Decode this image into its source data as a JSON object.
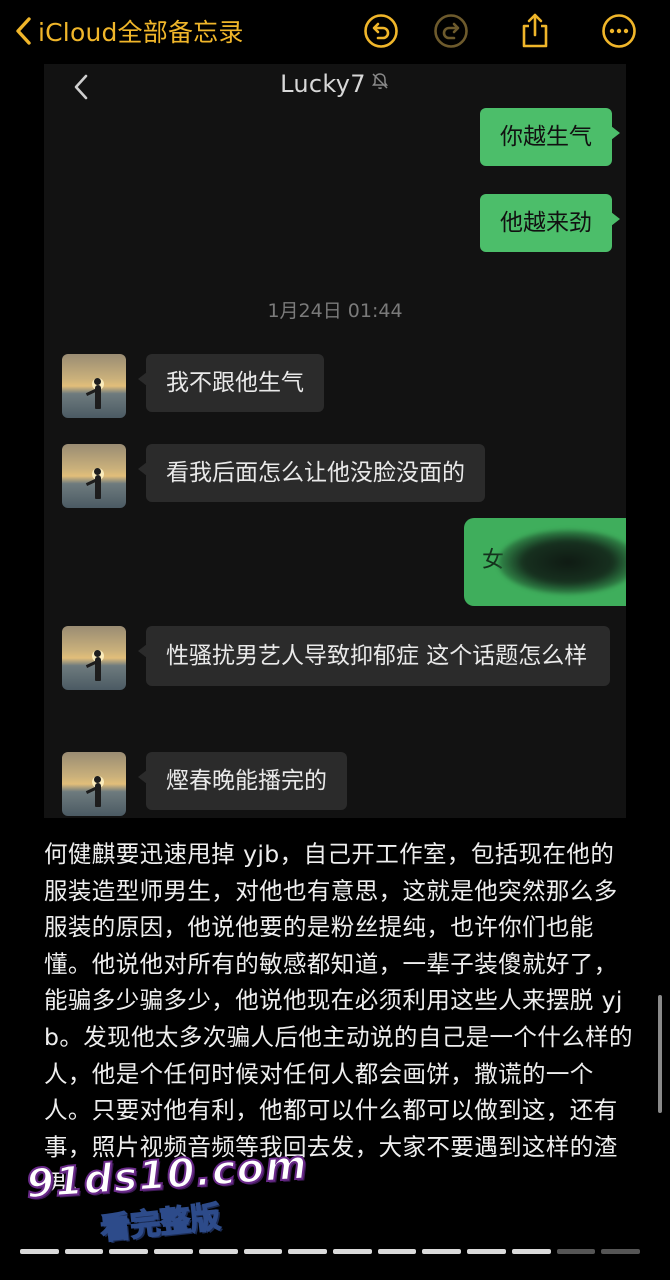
{
  "navbar": {
    "back_label": "iCloud全部备忘录",
    "accent_color": "#f0b62a",
    "icons": [
      "chevron-left-icon",
      "undo-icon",
      "redo-icon",
      "share-icon",
      "more-icon"
    ]
  },
  "chat": {
    "title": "Lucky7",
    "muted_icon": "bell-slash-icon",
    "messages": [
      {
        "side": "out",
        "text": "你越生气"
      },
      {
        "side": "out",
        "text": "他越来劲"
      },
      {
        "side": "in",
        "text": "我不跟他生气"
      },
      {
        "side": "in",
        "text": "看我后面怎么让他没脸没面的"
      },
      {
        "side": "in",
        "text": "性骚扰男艺人导致抑郁症 这个话题怎么样"
      },
      {
        "side": "in",
        "text": "熞春晚能播完的"
      }
    ],
    "timestamp": "1月24日 01:44",
    "redacted_mark": "女"
  },
  "note": {
    "body": "何健麒要迅速甩掉 yjb，自己开工作室，包括现在他的服装造型师男生，对他也有意思，这就是他突然那么多服装的原因，他说他要的是粉丝提纯，也许你们也能懂。他说他对所有的敏感都知道，一辈子装傻就好了，能骗多少骗多少，他说他现在必须利用这些人来摆脱 yjb。发现他太多次骗人后他主动说的自己是一个什么样的人，他是个任何时候对任何人都会画饼，撒谎的一个人。只要对他有利，他都可以什么都可以做到这，还有事，照片视频音频等我回去发，大家不要遇到这样的渣男。"
  },
  "watermark": {
    "url": "91ds10.com",
    "sub": "看完整版"
  },
  "progress": {
    "segments": 14,
    "filled": 12
  }
}
